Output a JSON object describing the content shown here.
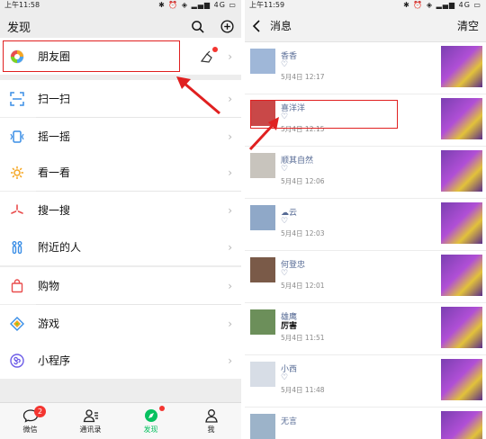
{
  "left": {
    "status": {
      "time": "上午11:58",
      "right": "✱ ⏰ ◈ ▂▄▆ 4G ▭"
    },
    "title": "发现",
    "items": [
      {
        "id": "moments",
        "label": "朋友圈",
        "icon": "moments-icon"
      },
      {
        "id": "scan",
        "label": "扫一扫",
        "icon": "scan-icon"
      },
      {
        "id": "shake",
        "label": "摇一摇",
        "icon": "shake-icon"
      },
      {
        "id": "look",
        "label": "看一看",
        "icon": "look-icon"
      },
      {
        "id": "search",
        "label": "搜一搜",
        "icon": "search-star-icon"
      },
      {
        "id": "nearby",
        "label": "附近的人",
        "icon": "nearby-icon"
      },
      {
        "id": "shop",
        "label": "购物",
        "icon": "shopping-bag-icon"
      },
      {
        "id": "games",
        "label": "游戏",
        "icon": "game-icon"
      },
      {
        "id": "mini",
        "label": "小程序",
        "icon": "miniprogram-icon"
      }
    ],
    "tabs": [
      {
        "label": "微信",
        "badge": "2"
      },
      {
        "label": "通讯录"
      },
      {
        "label": "发现"
      },
      {
        "label": "我"
      }
    ],
    "colors": {
      "accent": "#07c160",
      "alert": "#f43530",
      "annotation": "#e02020"
    }
  },
  "right": {
    "status": {
      "time": "上午11:59",
      "right": "✱ ⏰ ◈ ▂▄▆ 4G ▭"
    },
    "title": "消息",
    "clear_label": "清空",
    "messages": [
      {
        "name": "香香",
        "time": "5月4日 12:17",
        "heart": "♡"
      },
      {
        "name": "喜洋洋",
        "time": "5月4日 12:15",
        "heart": "♡"
      },
      {
        "name": "顺其自然",
        "time": "5月4日 12:06",
        "heart": "♡"
      },
      {
        "name": "☁云",
        "time": "5月4日 12:03",
        "heart": "♡"
      },
      {
        "name": "何登忠",
        "time": "5月4日 12:01",
        "heart": "♡"
      },
      {
        "name": "雄鹰",
        "comment": "厉害",
        "time": "5月4日 11:51"
      },
      {
        "name": "小西",
        "time": "5月4日 11:48",
        "heart": "♡"
      },
      {
        "name": "无言",
        "time": "",
        "heart": ""
      }
    ]
  }
}
